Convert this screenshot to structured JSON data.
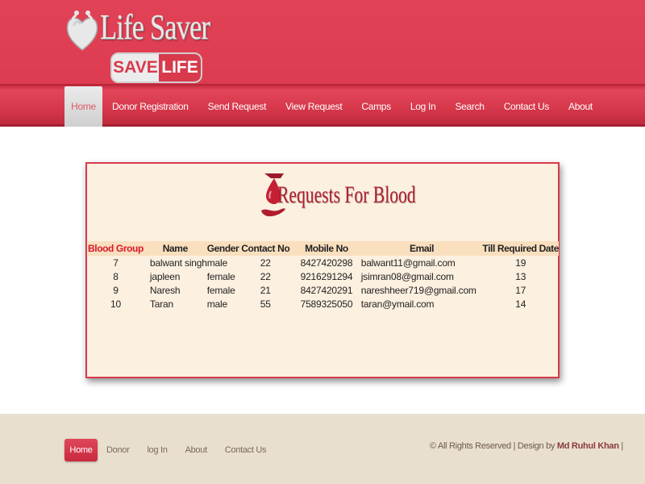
{
  "brand": {
    "title": "Life Saver",
    "badge_save": "SAVE",
    "badge_life": "LIFE"
  },
  "nav": {
    "items": [
      "Home",
      "Donor Registration",
      "Send Request",
      "View Request",
      "Camps",
      "Log In",
      "Search",
      "Contact Us",
      "About"
    ],
    "active": "Home"
  },
  "requests": {
    "heading": "Requests For Blood",
    "columns": [
      "Blood Group",
      "Name",
      "Gender",
      "Contact No",
      "Mobile No",
      "Email",
      "Till Required Date"
    ],
    "rows": [
      [
        "7",
        "balwant singh",
        "male",
        "22",
        "8427420298",
        "balwant11@gmail.com",
        "19"
      ],
      [
        "8",
        "japleen",
        "female",
        "22",
        "9216291294",
        "jsimran08@gmail.com",
        "13"
      ],
      [
        "9",
        "Naresh",
        "female",
        "21",
        "8427420291",
        "nareshheer719@gmail.com",
        "17"
      ],
      [
        "10",
        "Taran",
        "male",
        "55",
        "7589325050",
        "taran@ymail.com",
        "14"
      ]
    ]
  },
  "footer": {
    "nav": [
      "Home",
      "Donor",
      "log In",
      "About",
      "Contact Us"
    ],
    "copyright_prefix": "© All Rights Reserved | Design by ",
    "designer": "Md Ruhul Khan",
    "copyright_suffix": " |"
  },
  "colors": {
    "accent": "#d83a4c",
    "card_bg": "#fcf0e0",
    "table_header_bg": "#f9dfbe",
    "footer_bg": "#e9dfcf"
  },
  "icons": {
    "logo": "heart-hands-icon",
    "heading": "blood-drop-hand-icon"
  }
}
